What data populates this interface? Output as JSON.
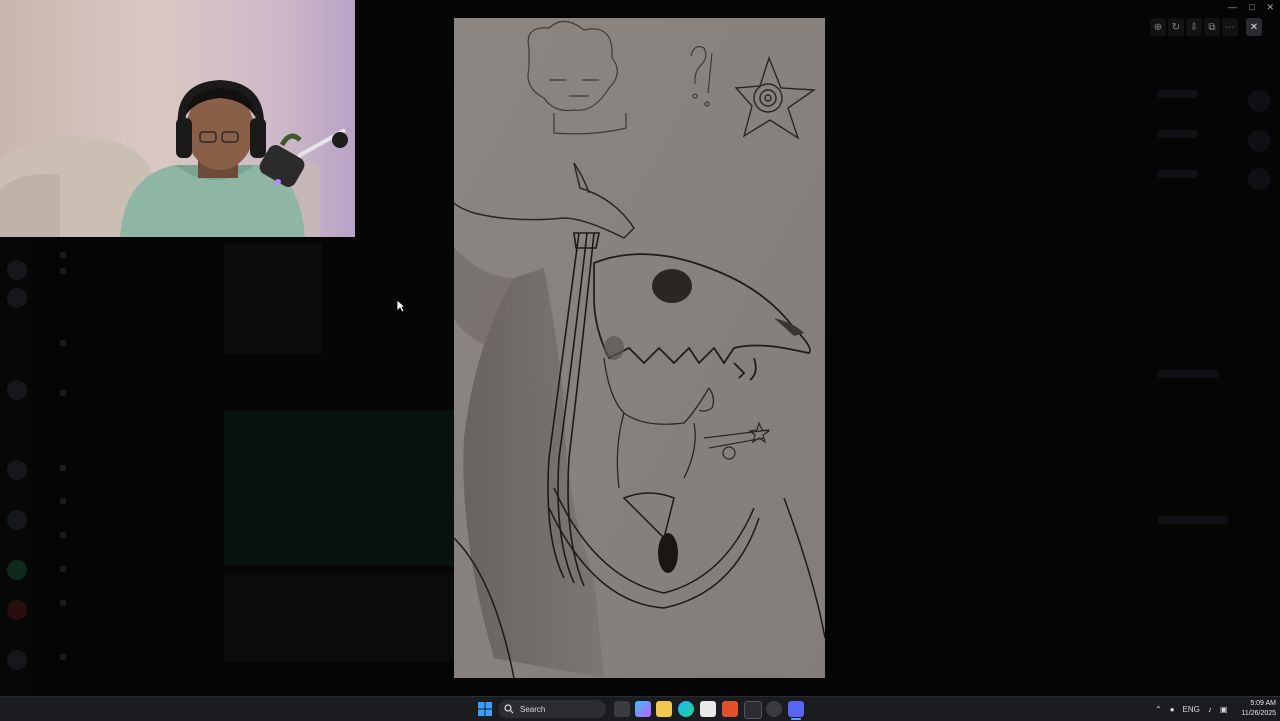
{
  "taskbar": {
    "search_label": "Search",
    "time": "5:09 AM",
    "date": "11/26/2025",
    "lang": "ENG"
  },
  "colors": {
    "taskbar_bg": "#1b1c20",
    "paper": "#8f8985",
    "pencil": "#2a2624"
  },
  "icons": [
    "search-icon",
    "windows-start-icon",
    "zoom-in-icon",
    "rotate-icon",
    "download-icon",
    "open-external-icon",
    "more-icon",
    "close-icon"
  ]
}
